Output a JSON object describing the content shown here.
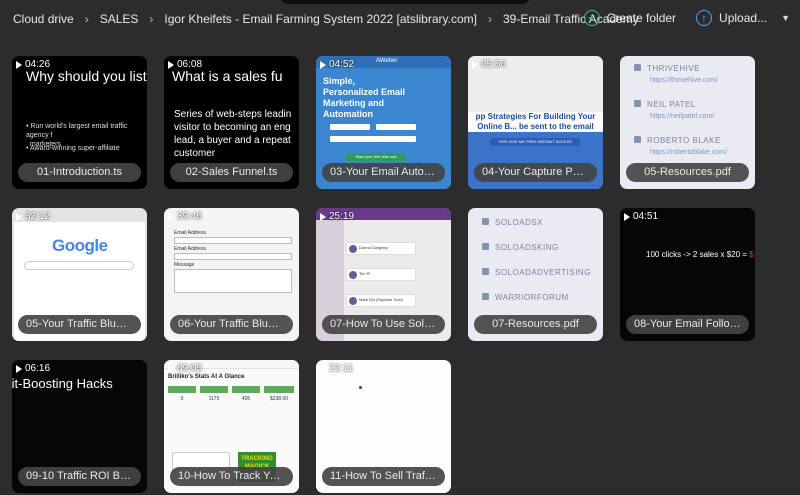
{
  "breadcrumb": [
    "Cloud drive",
    "SALES",
    "Igor Kheifets - Email Farming System 2022 [atslibrary.com]",
    "39-Email Traffic Academy"
  ],
  "actions": {
    "create_folder": "Create folder",
    "upload": "Upload..."
  },
  "colors": {
    "background": "#2c2c2c",
    "create_accent": "#3fbf7f",
    "upload_accent": "#4aa3ff"
  },
  "files": [
    {
      "name": "01-Introduction.ts",
      "duration": "04:26",
      "type": "video",
      "thumb_title": "Why should you liste",
      "thumb_lines": [
        "Run world's largest email traffic agency f",
        "marketers",
        "Award-winning super-affiliate"
      ]
    },
    {
      "name": "02-Sales Funnel.ts",
      "duration": "06:08",
      "type": "video",
      "thumb_title": "What is a sales fu",
      "thumb_text": "Series of web-steps leadin visitor to becoming an eng lead, a buyer and a repeat customer"
    },
    {
      "name": "03-Your Email Autore...",
      "duration": "04:52",
      "type": "video",
      "thumb_title": "Simple, Personalized Email Marketing and Automation",
      "thumb_brand": "AWeber",
      "thumb_button": "Start your free trial now"
    },
    {
      "name": "04-Your Capture Page...",
      "duration": "05:56",
      "type": "video",
      "thumb_banner": "pp Strategies For Building Your Online B... be sent to the email address you provide",
      "thumb_button": "YES! GIVE ME FREE INSTANT ACCESS"
    },
    {
      "name": "05-Resources.pdf",
      "type": "pdf",
      "thumb_items": [
        {
          "title": "THRIVEHIVE",
          "url": "https://thrivehive.com/"
        },
        {
          "title": "NEIL PATEL",
          "url": "https://neilpatel.com/"
        },
        {
          "title": "ROBERTO BLAKE",
          "url": "https://robertoblake.com/"
        }
      ]
    },
    {
      "name": "05-Your Traffic Bluepr...",
      "duration": "32:12",
      "type": "video",
      "thumb_logo": "Google"
    },
    {
      "name": "06-Your Traffic Bluepr...",
      "duration": "39:46",
      "type": "video",
      "thumb_labels": [
        "Email Address",
        "Email Address",
        "Message"
      ]
    },
    {
      "name": "07-How To Use Solo ...",
      "duration": "25:19",
      "type": "video",
      "thumb_labels": [
        "Donna Golightry",
        "Tim Pl",
        "Mark Eld (Superfor Solo)"
      ]
    },
    {
      "name": "07-Resources.pdf",
      "type": "pdf",
      "thumb_items": [
        {
          "title": "SOLOADSX"
        },
        {
          "title": "SOLOADSKING"
        },
        {
          "title": "SOLOADADVERTISING"
        },
        {
          "title": "WARRIORFORUM"
        }
      ]
    },
    {
      "name": "08-Your Email Follow ...",
      "duration": "04:51",
      "type": "video",
      "thumb_text": "100 clicks -> 2 sales x $20 =",
      "thumb_text_red": "$"
    },
    {
      "name": "09-10 Traffic ROI Boo...",
      "duration": "06:16",
      "type": "video",
      "thumb_title": "fit-Boosting Hacks"
    },
    {
      "name": "10-How To Track Your...",
      "duration": "09:05",
      "type": "video",
      "thumb_title": "Brilliko's Stats At A Glance",
      "thumb_stats": [
        "0",
        "1170",
        "405",
        "$238.00"
      ],
      "thumb_book": "TRACKING MAGICK"
    },
    {
      "name": "11-How To Sell Traffic...",
      "duration": "22:11",
      "type": "video"
    }
  ]
}
